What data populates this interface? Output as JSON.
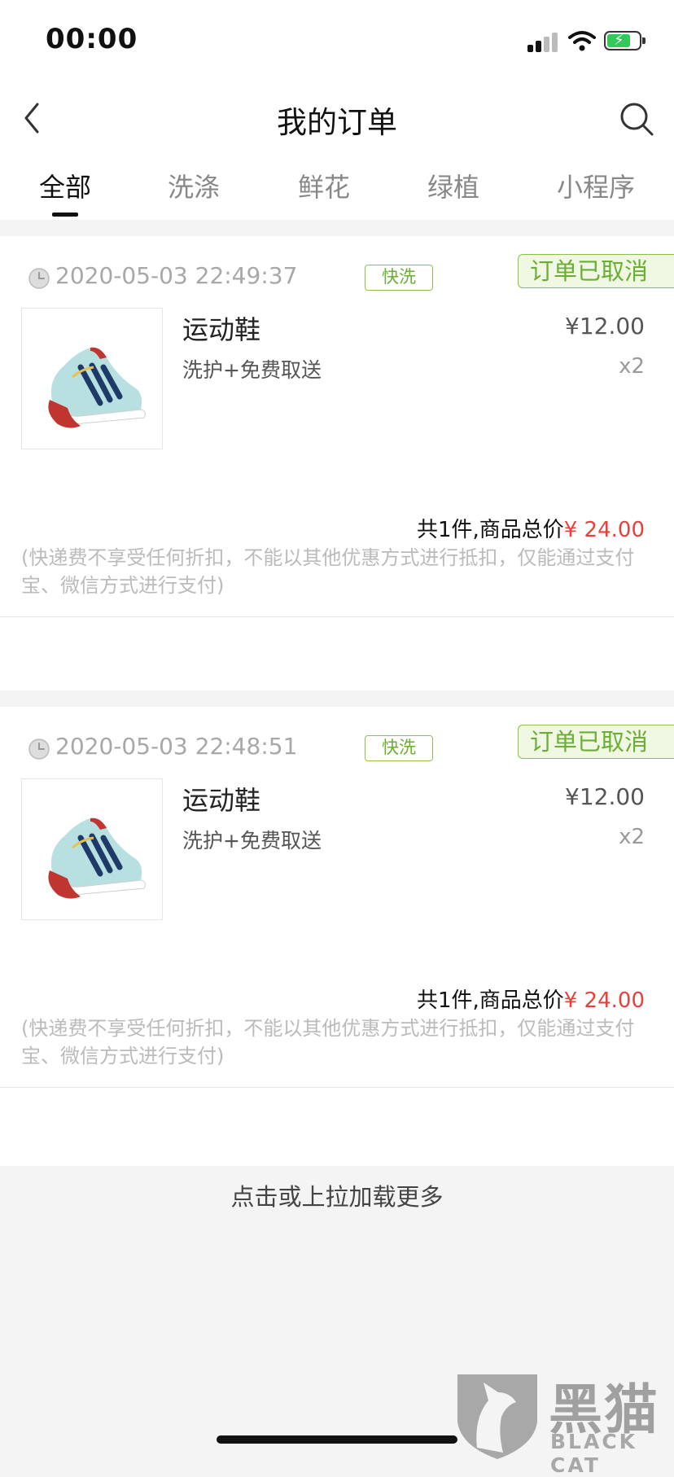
{
  "status_bar": {
    "time": "00:00"
  },
  "nav": {
    "title": "我的订单",
    "back_icon": "chevron-left-icon",
    "search_icon": "search-icon"
  },
  "tabs": [
    {
      "label": "全部",
      "active": true
    },
    {
      "label": "洗涤",
      "active": false
    },
    {
      "label": "鲜花",
      "active": false
    },
    {
      "label": "绿植",
      "active": false
    },
    {
      "label": "小程序",
      "active": false
    }
  ],
  "orders": [
    {
      "datetime": "2020-05-03 22:49:37",
      "badge": "快洗",
      "status": "订单已取消",
      "product_name": "运动鞋",
      "product_desc": "洗护+免费取送",
      "price": "¥12.00",
      "quantity": "x2",
      "total_label": "共1件,商品总价",
      "total_amount": "¥ 24.00",
      "note": "(快递费不享受任何折扣，不能以其他优惠方式进行抵扣，仅能通过支付宝、微信方式进行支付)"
    },
    {
      "datetime": "2020-05-03 22:48:51",
      "badge": "快洗",
      "status": "订单已取消",
      "product_name": "运动鞋",
      "product_desc": "洗护+免费取送",
      "price": "¥12.00",
      "quantity": "x2",
      "total_label": "共1件,商品总价",
      "total_amount": "¥ 24.00",
      "note": "(快递费不享受任何折扣，不能以其他优惠方式进行抵扣，仅能通过支付宝、微信方式进行支付)"
    }
  ],
  "load_more": "点击或上拉加载更多",
  "watermark": {
    "cn": "黑猫",
    "en": "BLACK CAT"
  },
  "colors": {
    "accent_green": "#6aae34",
    "price_red": "#e8413a"
  }
}
